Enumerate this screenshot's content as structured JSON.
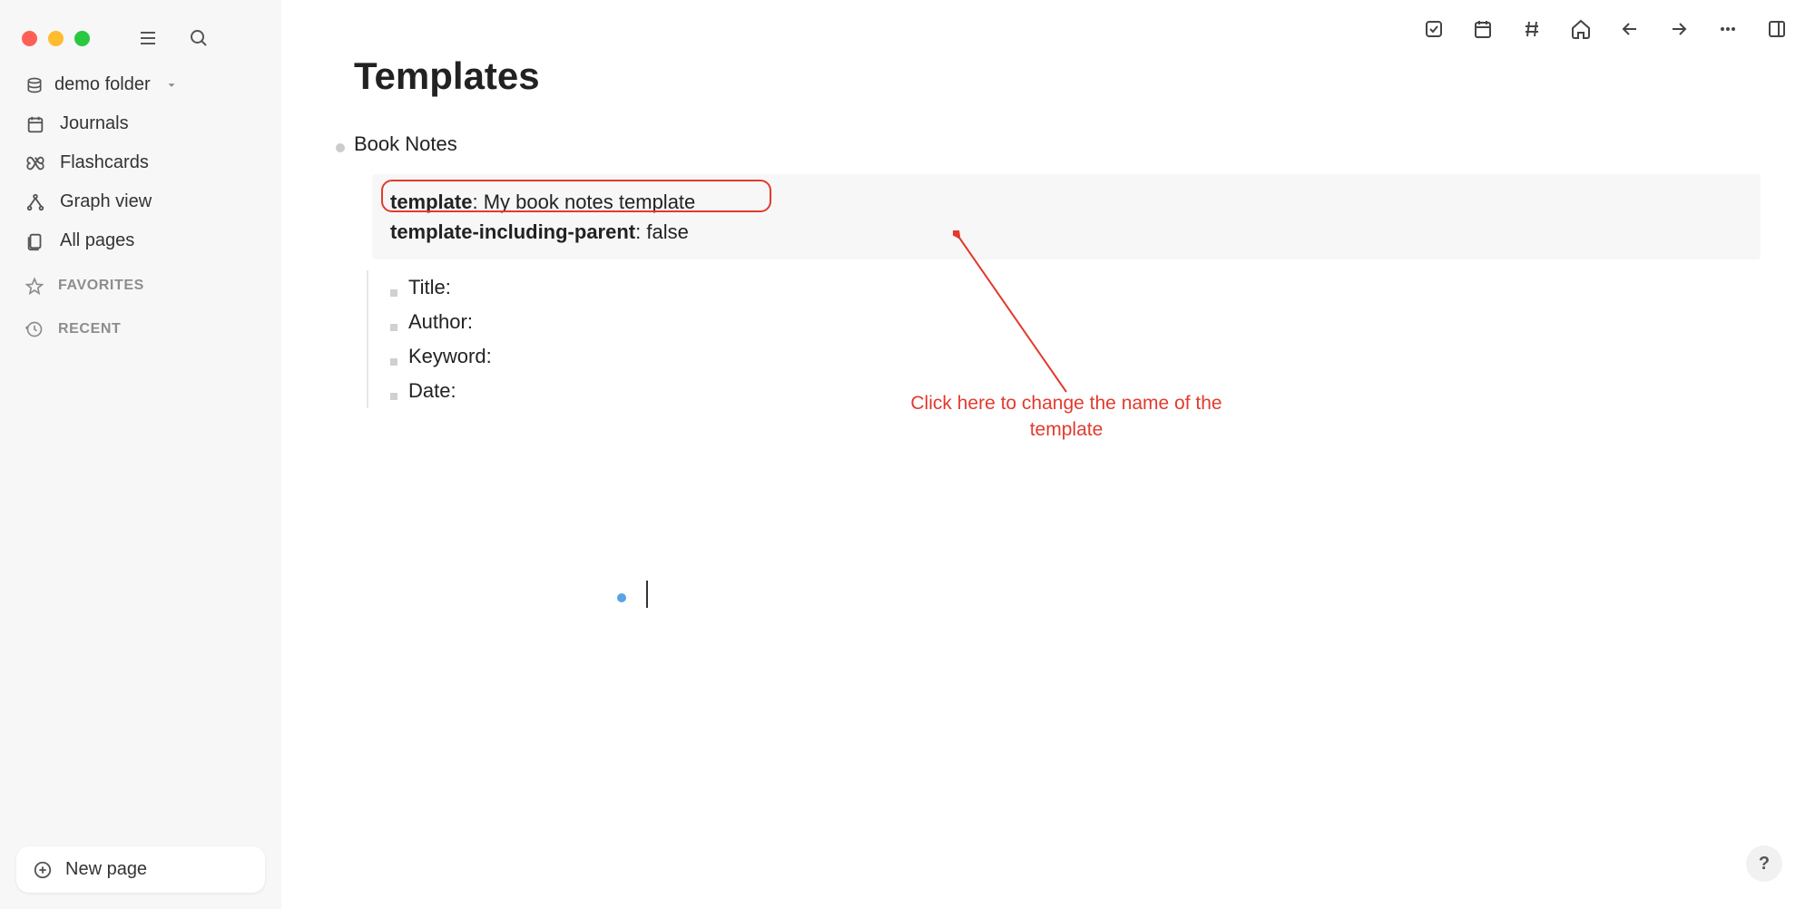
{
  "sidebar": {
    "folder_name": "demo folder",
    "nav": {
      "journals": "Journals",
      "flashcards": "Flashcards",
      "graph_view": "Graph view",
      "all_pages": "All pages"
    },
    "sections": {
      "favorites": "FAVORITES",
      "recent": "RECENT"
    },
    "new_page": "New page"
  },
  "page": {
    "title": "Templates",
    "block_title": "Book Notes",
    "template_props": {
      "template_key": "template",
      "template_value": ": My book notes template",
      "parent_key": "template-including-parent",
      "parent_value": ": false"
    },
    "fields": [
      "Title:",
      "Author:",
      "Keyword:",
      "Date:"
    ]
  },
  "annotation": {
    "text": "Click here to change the name of the template"
  },
  "help": "?"
}
